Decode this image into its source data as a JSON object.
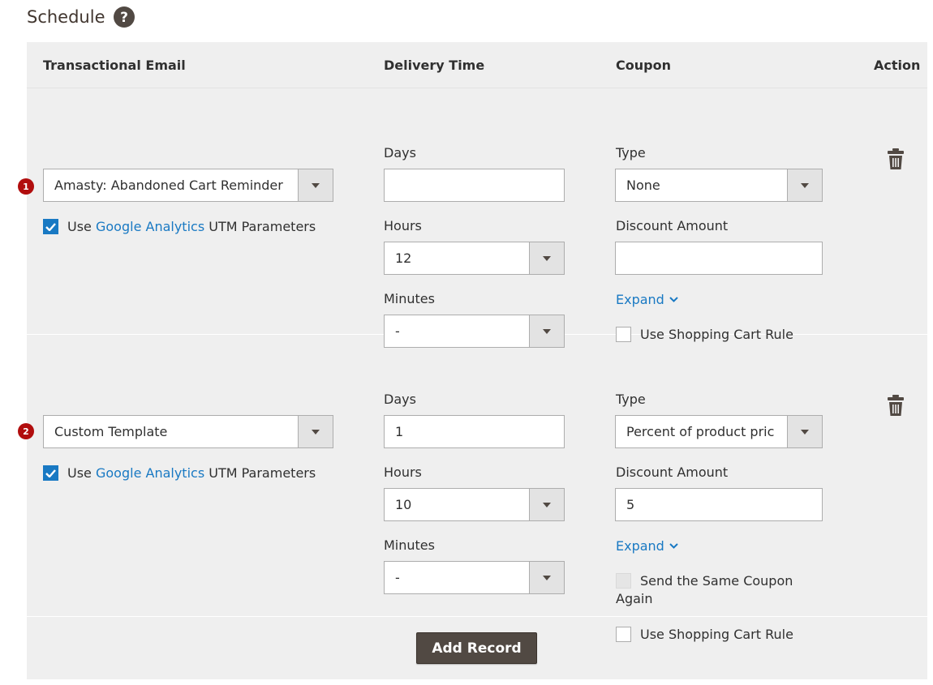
{
  "section": {
    "title": "Schedule",
    "help_icon": "question-circle-icon"
  },
  "columns": {
    "email": "Transactional Email",
    "delivery": "Delivery Time",
    "coupon": "Coupon",
    "action": "Action"
  },
  "rows": [
    {
      "badge": "1",
      "template": "Amasty: Abandoned Cart Reminder",
      "utm": {
        "prefix": "Use ",
        "link": "Google Analytics",
        "suffix": " UTM Parameters",
        "checked": true
      },
      "days_label": "Days",
      "days": "",
      "hours_label": "Hours",
      "hours": "12",
      "minutes_label": "Minutes",
      "minutes": "-",
      "type_label": "Type",
      "type": "None",
      "discount_label": "Discount Amount",
      "discount": "",
      "expand": "Expand",
      "shopping_cart_rule": "Use Shopping Cart Rule"
    },
    {
      "badge": "2",
      "template": "Custom Template",
      "utm": {
        "prefix": "Use ",
        "link": "Google Analytics",
        "suffix": " UTM Parameters",
        "checked": true
      },
      "days_label": "Days",
      "days": "1",
      "hours_label": "Hours",
      "hours": "10",
      "minutes_label": "Minutes",
      "minutes": "-",
      "type_label": "Type",
      "type": "Percent of product pric",
      "discount_label": "Discount Amount",
      "discount": "5",
      "expand": "Expand",
      "same_coupon_line1": "Send the Same Coupon",
      "same_coupon_line2": "Again",
      "shopping_cart_rule": "Use Shopping Cart Rule"
    }
  ],
  "add_record": "Add Record",
  "colors": {
    "accent": "#1979c3",
    "badge": "#b10d0d",
    "button": "#514943",
    "panel": "#efefef"
  }
}
